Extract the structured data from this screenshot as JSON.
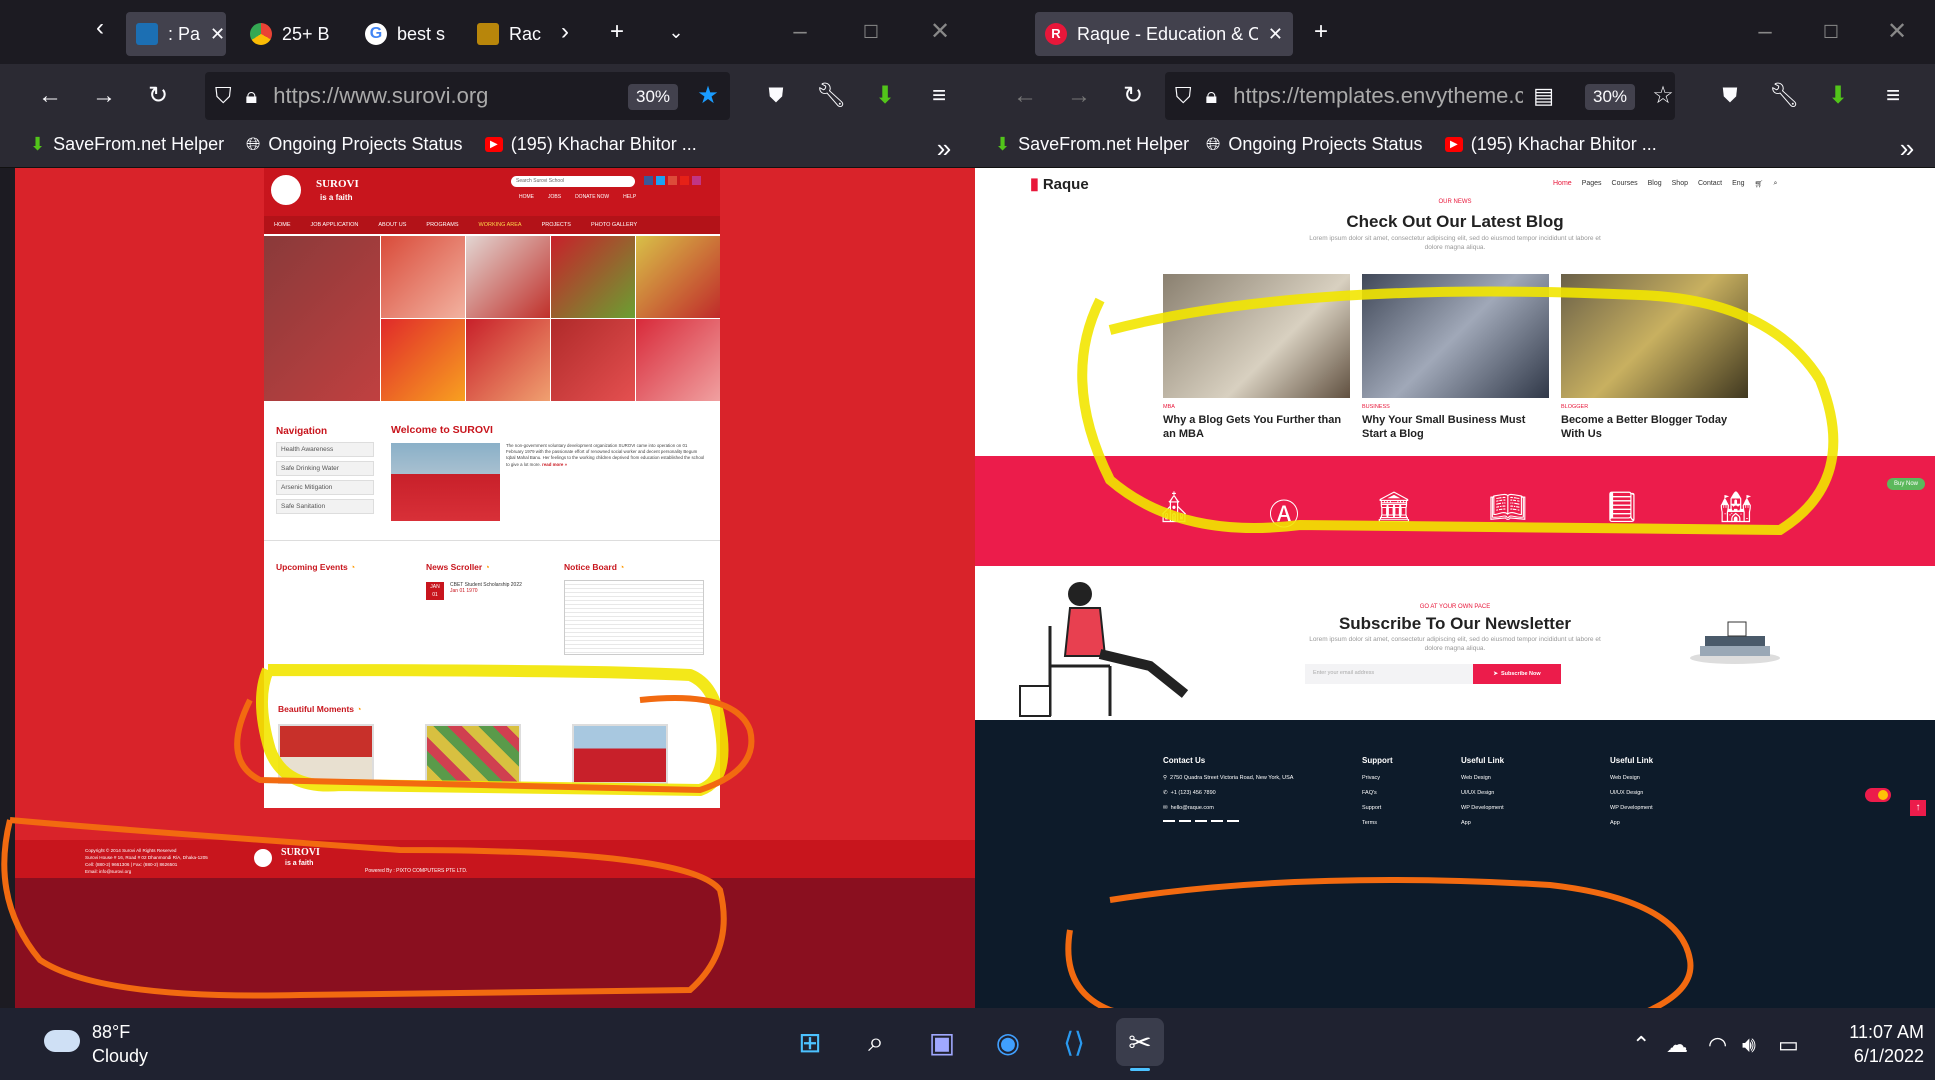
{
  "left_window": {
    "tabs": [
      {
        "label": ": Pa",
        "icon": "ls-icon"
      },
      {
        "label": "25+ B",
        "icon": "chrome-icon"
      },
      {
        "label": "best s",
        "icon": "google-icon"
      },
      {
        "label": "Rac",
        "icon": "book-icon"
      }
    ],
    "url": "https://www.surovi.org",
    "zoom": "30%",
    "bookmarks": [
      "SaveFrom.net Helper",
      "Ongoing Projects Status",
      "(195) Khachar Bhitor ..."
    ]
  },
  "right_window": {
    "tabs": [
      {
        "label": "Raque - Education & Online Co",
        "icon": "raque-icon"
      }
    ],
    "url": "https://templates.envytheme.c",
    "zoom": "30%",
    "bookmarks": [
      "SaveFrom.net Helper",
      "Ongoing Projects Status",
      "(195) Khachar Bhitor ..."
    ]
  },
  "surovi": {
    "logo_text": "SUROVI",
    "tagline": "is a faith",
    "search_placeholder": "Search Surovi School",
    "top_links": [
      "HOME",
      "JOBS",
      "DONATE NOW",
      "HELP"
    ],
    "menu": [
      "HOME",
      "JOB APPLICATION",
      "ABOUT US",
      "PROGRAMS",
      "WORKING AREA",
      "PROJECTS",
      "PHOTO GALLERY"
    ],
    "navigation_title": "Navigation",
    "nav_items": [
      "Health Awareness",
      "Safe Drinking Water",
      "Arsenic Mitigation",
      "Safe Sanitation"
    ],
    "welcome_title": "Welcome to SUROVI",
    "welcome_text": "The non-government voluntary development organization SUROVI came into operation on 01 February 1979 with the passionate effort of renowned social worker and decent personality Begum Iqbal Mahal Banu. Her feelings to the working children deprived from education established the school to give a lot more.",
    "read_more": "read more »",
    "upcoming_events": "Upcoming Events",
    "news_scroller": "News Scroller",
    "news_item": {
      "month": "JAN",
      "day": "01",
      "title": "CBET Student Scholarship 2022",
      "date": "Jan 01 1970"
    },
    "notice_board": "Notice Board",
    "beautiful_moments": "Beautiful Moments",
    "footer_copyright": "Copyright © 2014 Surovi All Rights Reserved",
    "footer_address": "Surovi House # 16, Road # 02 Dhanmondi R/A, Dhaka-1205",
    "footer_cell": "Cell: (880-2) 9661306 | Fax: (880-2) 8626501",
    "footer_email": "Email: info@surovi.org",
    "powered_by": "Powered By : PIXTO COMPUTERS PTE LTD."
  },
  "raque": {
    "logo": "Raque",
    "menu": [
      "Home",
      "Pages",
      "Courses",
      "Blog",
      "Shop",
      "Contact",
      "Eng"
    ],
    "section_tag": "OUR NEWS",
    "section_title": "Check Out Our Latest Blog",
    "section_sub": "Lorem ipsum dolor sit amet, consectetur adipiscing elit, sed do eiusmod tempor incididunt ut labore et dolore magna aliqua.",
    "posts": [
      {
        "category": "MBA",
        "title": "Why a Blog Gets You Further than an MBA"
      },
      {
        "category": "BUSINESS",
        "title": "Why Your Small Business Must Start a Blog"
      },
      {
        "category": "BLOGGER",
        "title": "Become a Better Blogger Today With Us"
      }
    ],
    "buy_now": "Buy Now",
    "newsletter_tag": "GO AT YOUR OWN PACE",
    "newsletter_title": "Subscribe To Our Newsletter",
    "newsletter_sub": "Lorem ipsum dolor sit amet, consectetur adipiscing elit, sed do eiusmod tempor incididunt ut labore et dolore magna aliqua.",
    "email_placeholder": "Enter your email address",
    "subscribe_btn": "Subscribe Now",
    "footer": {
      "contact_title": "Contact Us",
      "contact": [
        "2750 Quadra Street Victoria Road, New York, USA",
        "+1 (123) 456 7890",
        "hello@raque.com"
      ],
      "support_title": "Support",
      "support": [
        "Privacy",
        "FAQ's",
        "Support",
        "Terms"
      ],
      "useful1_title": "Useful Link",
      "useful1": [
        "Web Design",
        "UI/UX Design",
        "WP Development",
        "App"
      ],
      "useful2_title": "Useful Link",
      "useful2": [
        "Web Design",
        "UI/UX Design",
        "WP Development",
        "App"
      ]
    }
  },
  "taskbar": {
    "weather_temp": "88°F",
    "weather_desc": "Cloudy",
    "time": "11:07 AM",
    "date": "6/1/2022"
  }
}
